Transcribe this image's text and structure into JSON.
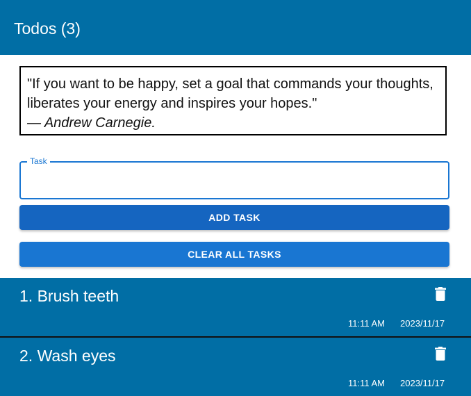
{
  "header": {
    "title": "Todos (3)"
  },
  "quote": {
    "text": "\"If you want to be happy, set a goal that commands your thoughts, liberates your energy and inspires your hopes.\"",
    "author": "— Andrew Carnegie."
  },
  "task_input": {
    "label": "Task",
    "value": ""
  },
  "buttons": {
    "add": "ADD TASK",
    "clear": "CLEAR ALL TASKS"
  },
  "todos": [
    {
      "label": "1. Brush teeth",
      "time": "11:11 AM",
      "date": "2023/11/17",
      "icon": "trash-icon"
    },
    {
      "label": "2. Wash eyes",
      "time": "11:11 AM",
      "date": "2023/11/17",
      "icon": "trash-icon"
    }
  ],
  "colors": {
    "header_bg": "#016ea5",
    "primary": "#1976d2",
    "primary_dark": "#1565c0",
    "todo_bg": "#016ea5"
  }
}
